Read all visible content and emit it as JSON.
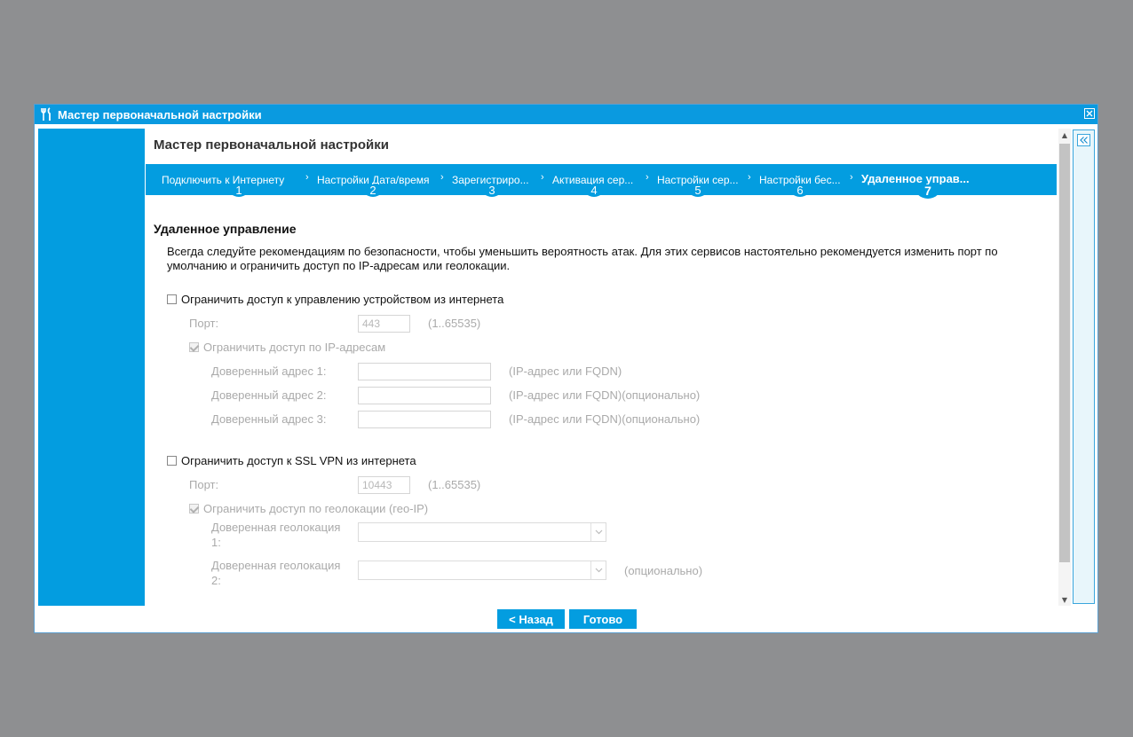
{
  "window": {
    "title": "Мастер первоначальной настройки"
  },
  "wizard": {
    "title": "Мастер первоначальной настройки",
    "steps": [
      {
        "label": "Подключить к Интернету",
        "num": "1"
      },
      {
        "label": "Настройки Дата/время",
        "num": "2"
      },
      {
        "label": "Зарегистриро...",
        "num": "3"
      },
      {
        "label": "Активация сер...",
        "num": "4"
      },
      {
        "label": "Настройки сер...",
        "num": "5"
      },
      {
        "label": "Настройки бес...",
        "num": "6"
      },
      {
        "label": "Удаленное управ...",
        "num": "7"
      }
    ],
    "active_step": 7
  },
  "section": {
    "title": "Удаленное управление",
    "description": "Всегда следуйте рекомендациям по безопасности, чтобы уменьшить вероятность атак. Для этих сервисов настоятельно рекомендуется изменить порт по умолчанию и ограничить доступ по IP-адресам или геолокации."
  },
  "mgmt": {
    "checkbox_label": "Ограничить доступ к управлению устройством из интернета",
    "checked": false,
    "port_label": "Порт:",
    "port_value": "443",
    "port_hint": "(1..65535)",
    "ip_checkbox_label": "Ограничить доступ по IP-адресам",
    "ip_checked": true,
    "addresses": [
      {
        "label": "Доверенный адрес 1:",
        "value": "",
        "hint": "(IP-адрес или FQDN)"
      },
      {
        "label": "Доверенный адрес 2:",
        "value": "",
        "hint": "(IP-адрес или FQDN)(опционально)"
      },
      {
        "label": "Доверенный адрес 3:",
        "value": "",
        "hint": "(IP-адрес или FQDN)(опционально)"
      }
    ]
  },
  "vpn": {
    "checkbox_label": "Ограничить доступ к SSL VPN из интернета",
    "checked": false,
    "port_label": "Порт:",
    "port_value": "10443",
    "port_hint": "(1..65535)",
    "geo_checkbox_label": "Ограничить доступ по геолокации (гео-IP)",
    "geo_checked": true,
    "geo": [
      {
        "label_line1": "Доверенная геолокация",
        "label_line2": "1:",
        "value": "",
        "hint": ""
      },
      {
        "label_line1": "Доверенная геолокация",
        "label_line2": "2:",
        "value": "",
        "hint": "(опционально)"
      }
    ]
  },
  "buttons": {
    "back": "< Назад",
    "finish": "Готово"
  },
  "colors": {
    "accent": "#039de0",
    "backdrop": "#8e8f91",
    "disabled_text": "#aaaaaa"
  },
  "icons": [
    "tools-icon",
    "close-icon",
    "collapse-double-chevron-icon",
    "scroll-up-icon",
    "scroll-down-icon",
    "chevron-down-icon"
  ]
}
